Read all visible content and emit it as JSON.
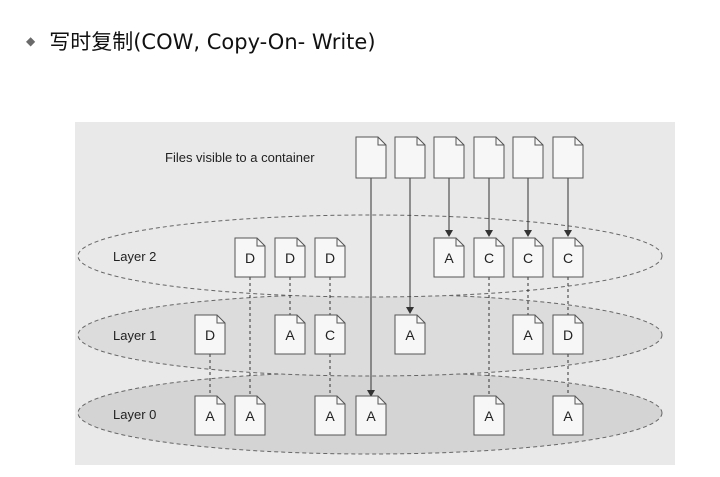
{
  "slide": {
    "bullet_icon": "diamond-bullet-icon",
    "title": "写时复制(COW, Copy-On- Write)"
  },
  "diagram": {
    "caption": "Files visible to a container",
    "layers": [
      {
        "name": "Layer 2"
      },
      {
        "name": "Layer 1"
      },
      {
        "name": "Layer 0"
      }
    ],
    "layer2_files": [
      "D",
      "D",
      "D",
      "A",
      "C",
      "C",
      "C"
    ],
    "layer1_files": [
      "D",
      "A",
      "C",
      "A",
      "A",
      "D"
    ],
    "layer0_files": [
      "A",
      "A",
      "A",
      "A",
      "A",
      "A"
    ]
  }
}
